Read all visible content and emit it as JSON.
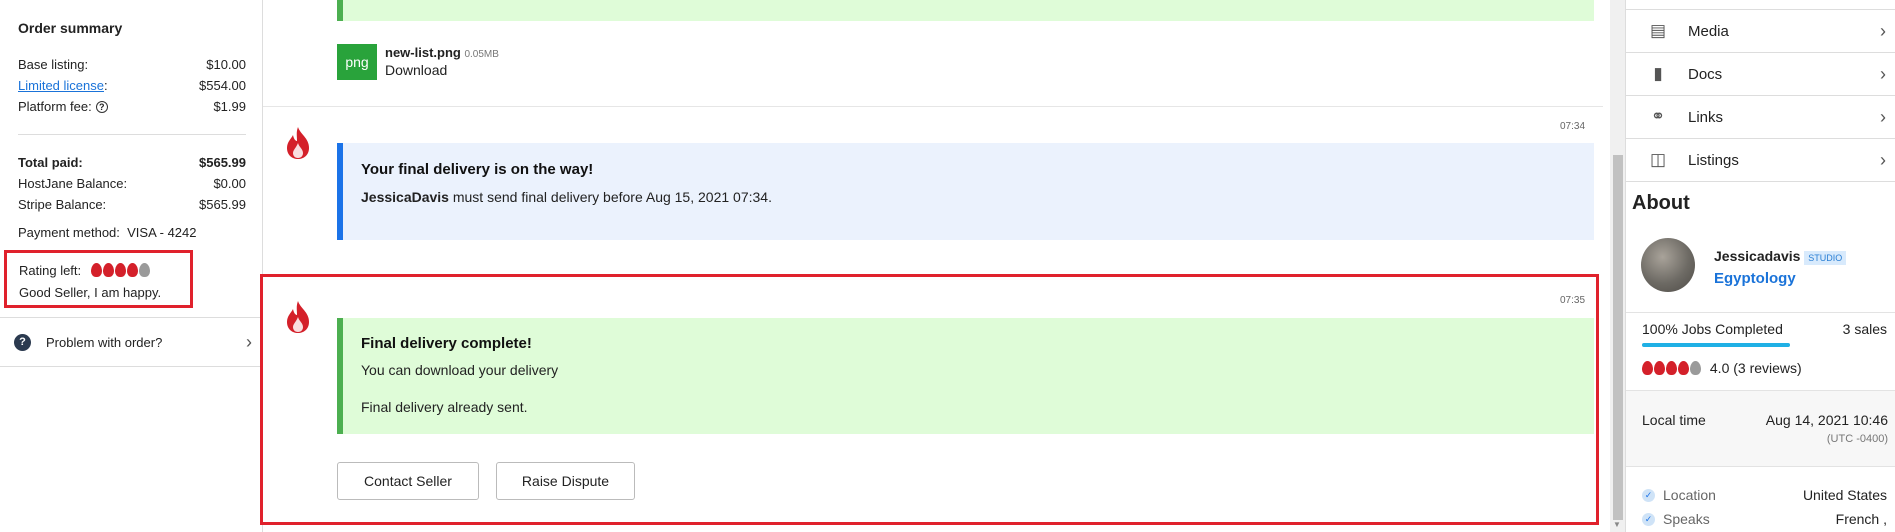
{
  "order_summary": {
    "title": "Order summary",
    "base_listing_label": "Base listing:",
    "base_listing_value": "$10.00",
    "license_label": "Limited license",
    "license_colon": ":",
    "license_value": "$554.00",
    "platform_fee_label": "Platform fee:",
    "platform_fee_value": "$1.99",
    "total_paid_label": "Total paid:",
    "total_paid_value": "$565.99",
    "hostjane_balance_label": "HostJane Balance:",
    "hostjane_balance_value": "$0.00",
    "stripe_balance_label": "Stripe Balance:",
    "stripe_balance_value": "$565.99",
    "payment_method": "Payment method:  VISA - 4242",
    "rating_label": "Rating left:",
    "rating_value": 4,
    "rating_max": 5,
    "rating_comment": "Good Seller, I am happy.",
    "problem_label": "Problem with order?"
  },
  "messages": {
    "attachment_name": "new-list.png",
    "attachment_size": "0.05MB",
    "attachment_ext": "png",
    "download_label": "Download",
    "msg1_time": "07:34",
    "msg1_title": "Your final delivery is on the way!",
    "msg1_user": "JessicaDavis",
    "msg1_text": " must send final delivery before Aug 15, 2021 07:34.",
    "msg2_time": "07:35",
    "msg2_title": "Final delivery complete!",
    "msg2_line1": "You can download your delivery",
    "msg2_line2": "Final delivery already sent.",
    "contact_seller": "Contact Seller",
    "raise_dispute": "Raise Dispute"
  },
  "sidebar": {
    "menu": [
      {
        "label": "Media",
        "icon": "image-icon"
      },
      {
        "label": "Docs",
        "icon": "document-icon"
      },
      {
        "label": "Links",
        "icon": "link-icon"
      },
      {
        "label": "Listings",
        "icon": "listings-icon"
      }
    ],
    "about_title": "About",
    "seller_name": "Jessicadavis",
    "seller_badge": "STUDIO",
    "seller_category": "Egyptology",
    "jobs_completed": "100% Jobs Completed",
    "jobs_completed_fraction": 1.0,
    "sales": "3 sales",
    "seller_rating": 4,
    "rating_text": "4.0 (3 reviews)",
    "local_time_label": "Local time",
    "local_time_value": "Aug 14, 2021 10:46",
    "timezone": "(UTC -0400)",
    "location_label": "Location",
    "location_value": "United States",
    "speaks_label": "Speaks",
    "speaks_value": "French ,"
  },
  "colors": {
    "highlight_red": "#e0212c",
    "flame_red": "#d4202a",
    "green_message": "#dffcd8",
    "blue_message": "#ebf2fd",
    "link_blue": "#1a73d9"
  }
}
